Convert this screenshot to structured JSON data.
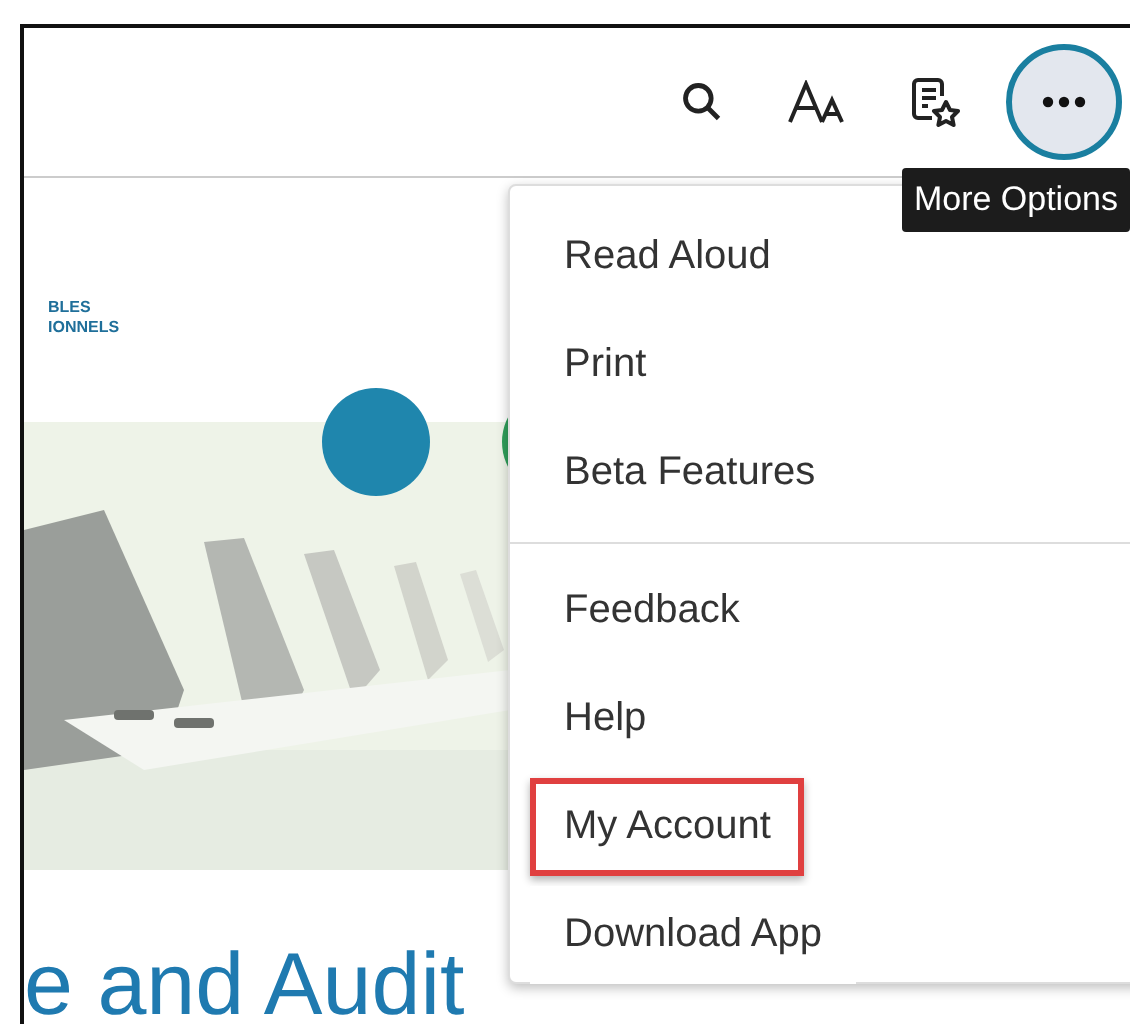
{
  "toolbar": {
    "more_button": {
      "selected": true
    },
    "tooltip": "More Options"
  },
  "logo": [
    "BLES",
    "IONNELS"
  ],
  "hero": {
    "kind": "picture"
  },
  "heading": "e and Audit",
  "menu": {
    "groups": [
      [
        {
          "label": "Read Aloud",
          "highlighted": false
        },
        {
          "label": "Print",
          "highlighted": false
        },
        {
          "label": "Beta Features",
          "highlighted": false
        }
      ],
      [
        {
          "label": "Feedback",
          "highlighted": false
        },
        {
          "label": "Help",
          "highlighted": false
        },
        {
          "label": "My Account",
          "highlighted": true
        },
        {
          "label": "Download App",
          "highlighted": false
        }
      ]
    ]
  }
}
